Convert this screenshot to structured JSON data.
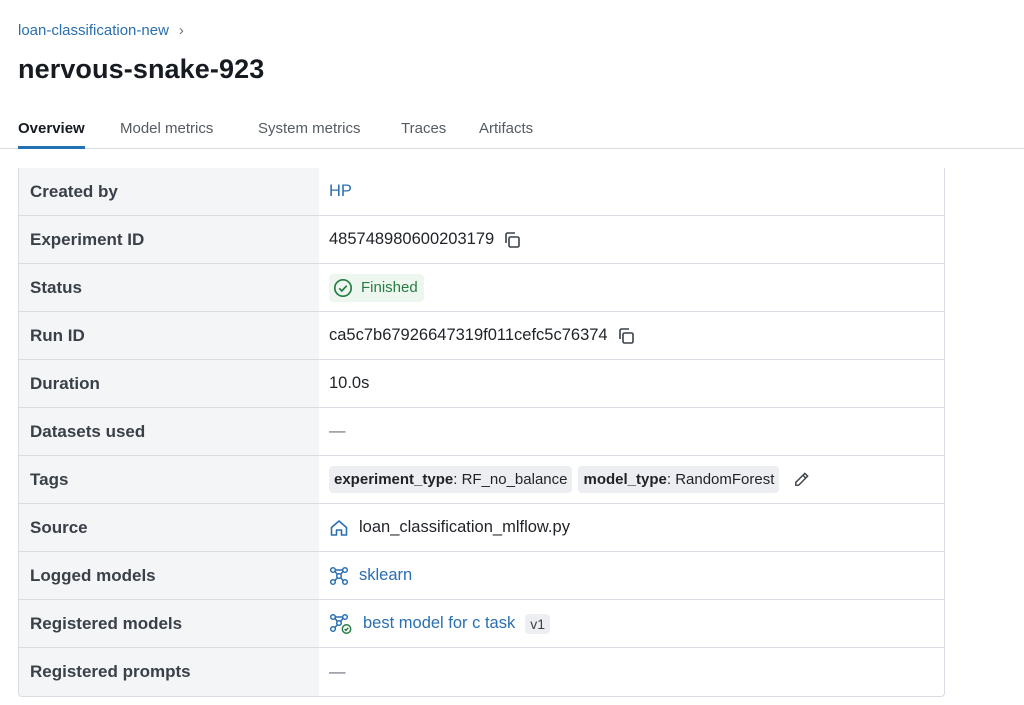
{
  "breadcrumb": {
    "experiment": "loan-classification-new",
    "separator": "›"
  },
  "title": "nervous-snake-923",
  "tabs": [
    "Overview",
    "Model metrics",
    "System metrics",
    "Traces",
    "Artifacts"
  ],
  "active_tab": "Overview",
  "details": {
    "created_by": {
      "label": "Created by",
      "value": "HP"
    },
    "experiment_id": {
      "label": "Experiment ID",
      "value": "485748980600203179"
    },
    "status": {
      "label": "Status",
      "value": "Finished"
    },
    "run_id": {
      "label": "Run ID",
      "value": "ca5c7b67926647319f011cefc5c76374"
    },
    "duration": {
      "label": "Duration",
      "value": "10.0s"
    },
    "datasets_used": {
      "label": "Datasets used",
      "value": "—"
    },
    "tags": {
      "label": "Tags",
      "items": [
        {
          "key": "experiment_type",
          "value": "RF_no_balance"
        },
        {
          "key": "model_type",
          "value": "RandomForest"
        }
      ]
    },
    "source": {
      "label": "Source",
      "value": "loan_classification_mlflow.py"
    },
    "logged_models": {
      "label": "Logged models",
      "value": "sklearn"
    },
    "registered_models": {
      "label": "Registered models",
      "value": "best model for c task",
      "version": "v1"
    },
    "registered_prompts": {
      "label": "Registered prompts",
      "value": "—"
    }
  },
  "colors": {
    "link": "#2a6fb0",
    "accent": "#2272b4",
    "success": "#277c43"
  },
  "icons": [
    "chevron-right-icon",
    "copy-icon",
    "check-circle-icon",
    "pencil-icon",
    "home-icon",
    "model-icon",
    "registered-model-icon"
  ]
}
